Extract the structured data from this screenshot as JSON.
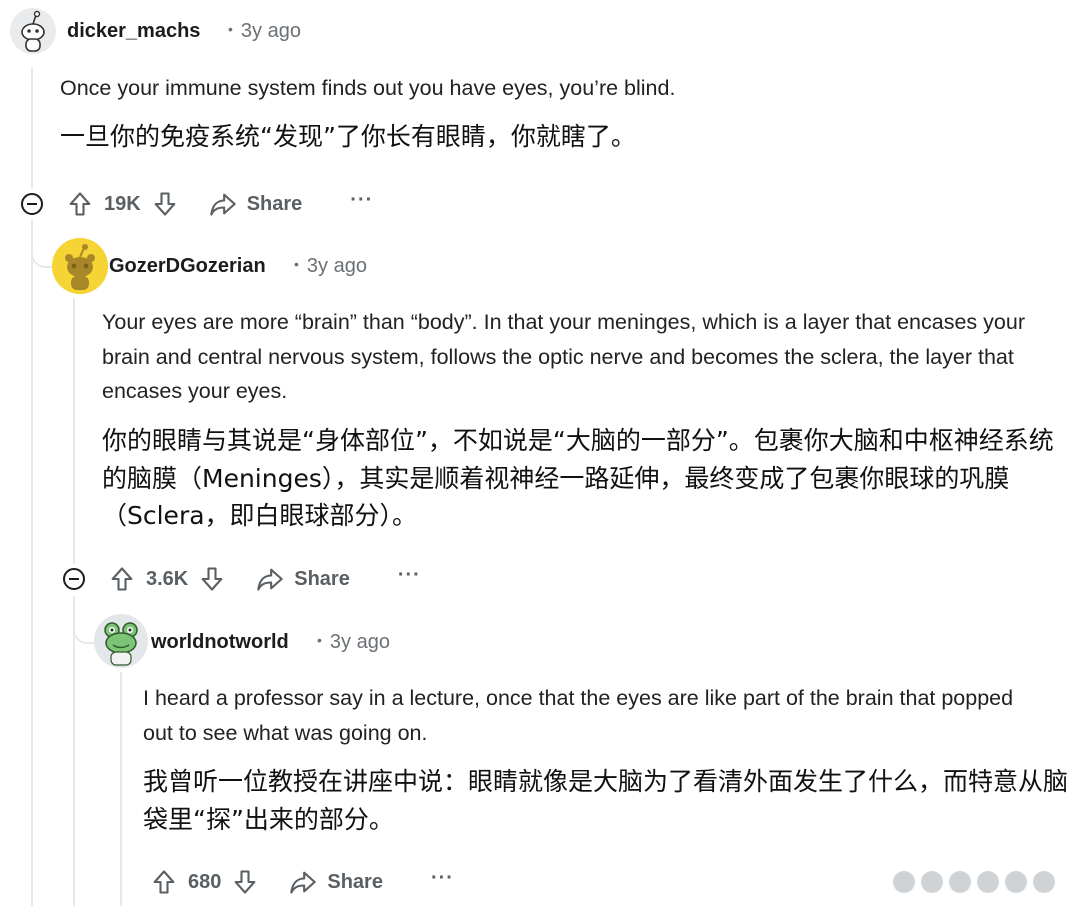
{
  "comments": [
    {
      "username": "dicker_machs",
      "age": "3y ago",
      "text_en": "Once your immune system finds out you have eyes, you’re blind.",
      "text_zh": "一旦你的免疫系统“发现”了你长有眼睛，你就瞎了。",
      "votes": "19K",
      "share_label": "Share",
      "more": "···"
    },
    {
      "username": "GozerDGozerian",
      "age": "3y ago",
      "text_en": "Your eyes are more “brain” than “body”. In that your meninges, which is a layer that encases your brain and central nervous system, follows the optic nerve and becomes the sclera, the layer that encases your eyes.",
      "text_zh": "你的眼睛与其说是“身体部位”，不如说是“大脑的一部分”。包裹你大脑和中枢神经系统的脑膜（Meninges），其实是顺着视神经一路延伸，最终变成了包裹你眼球的巩膜（Sclera，即白眼球部分）。",
      "votes": "3.6K",
      "share_label": "Share",
      "more": "···"
    },
    {
      "username": "worldnotworld",
      "age": "3y ago",
      "text_en": "I heard a professor say in a lecture, once that the eyes are like part of the brain that popped out to see what was going on.",
      "text_zh": "我曾听一位教授在讲座中说：眼睛就像是大脑为了看清外面发生了什么，而特意从脑袋里“探”出来的部分。",
      "votes": "680",
      "share_label": "Share",
      "more": "···"
    }
  ],
  "icons": {
    "upvote": "arrow-up-icon",
    "downvote": "arrow-down-icon",
    "share": "share-arrow-icon",
    "collapse": "collapse-minus-icon",
    "more": "more-options-icon"
  },
  "colors": {
    "thread_line": "#e6e8ea",
    "meta_text": "#6b7074",
    "action_text": "#5a5f63"
  }
}
